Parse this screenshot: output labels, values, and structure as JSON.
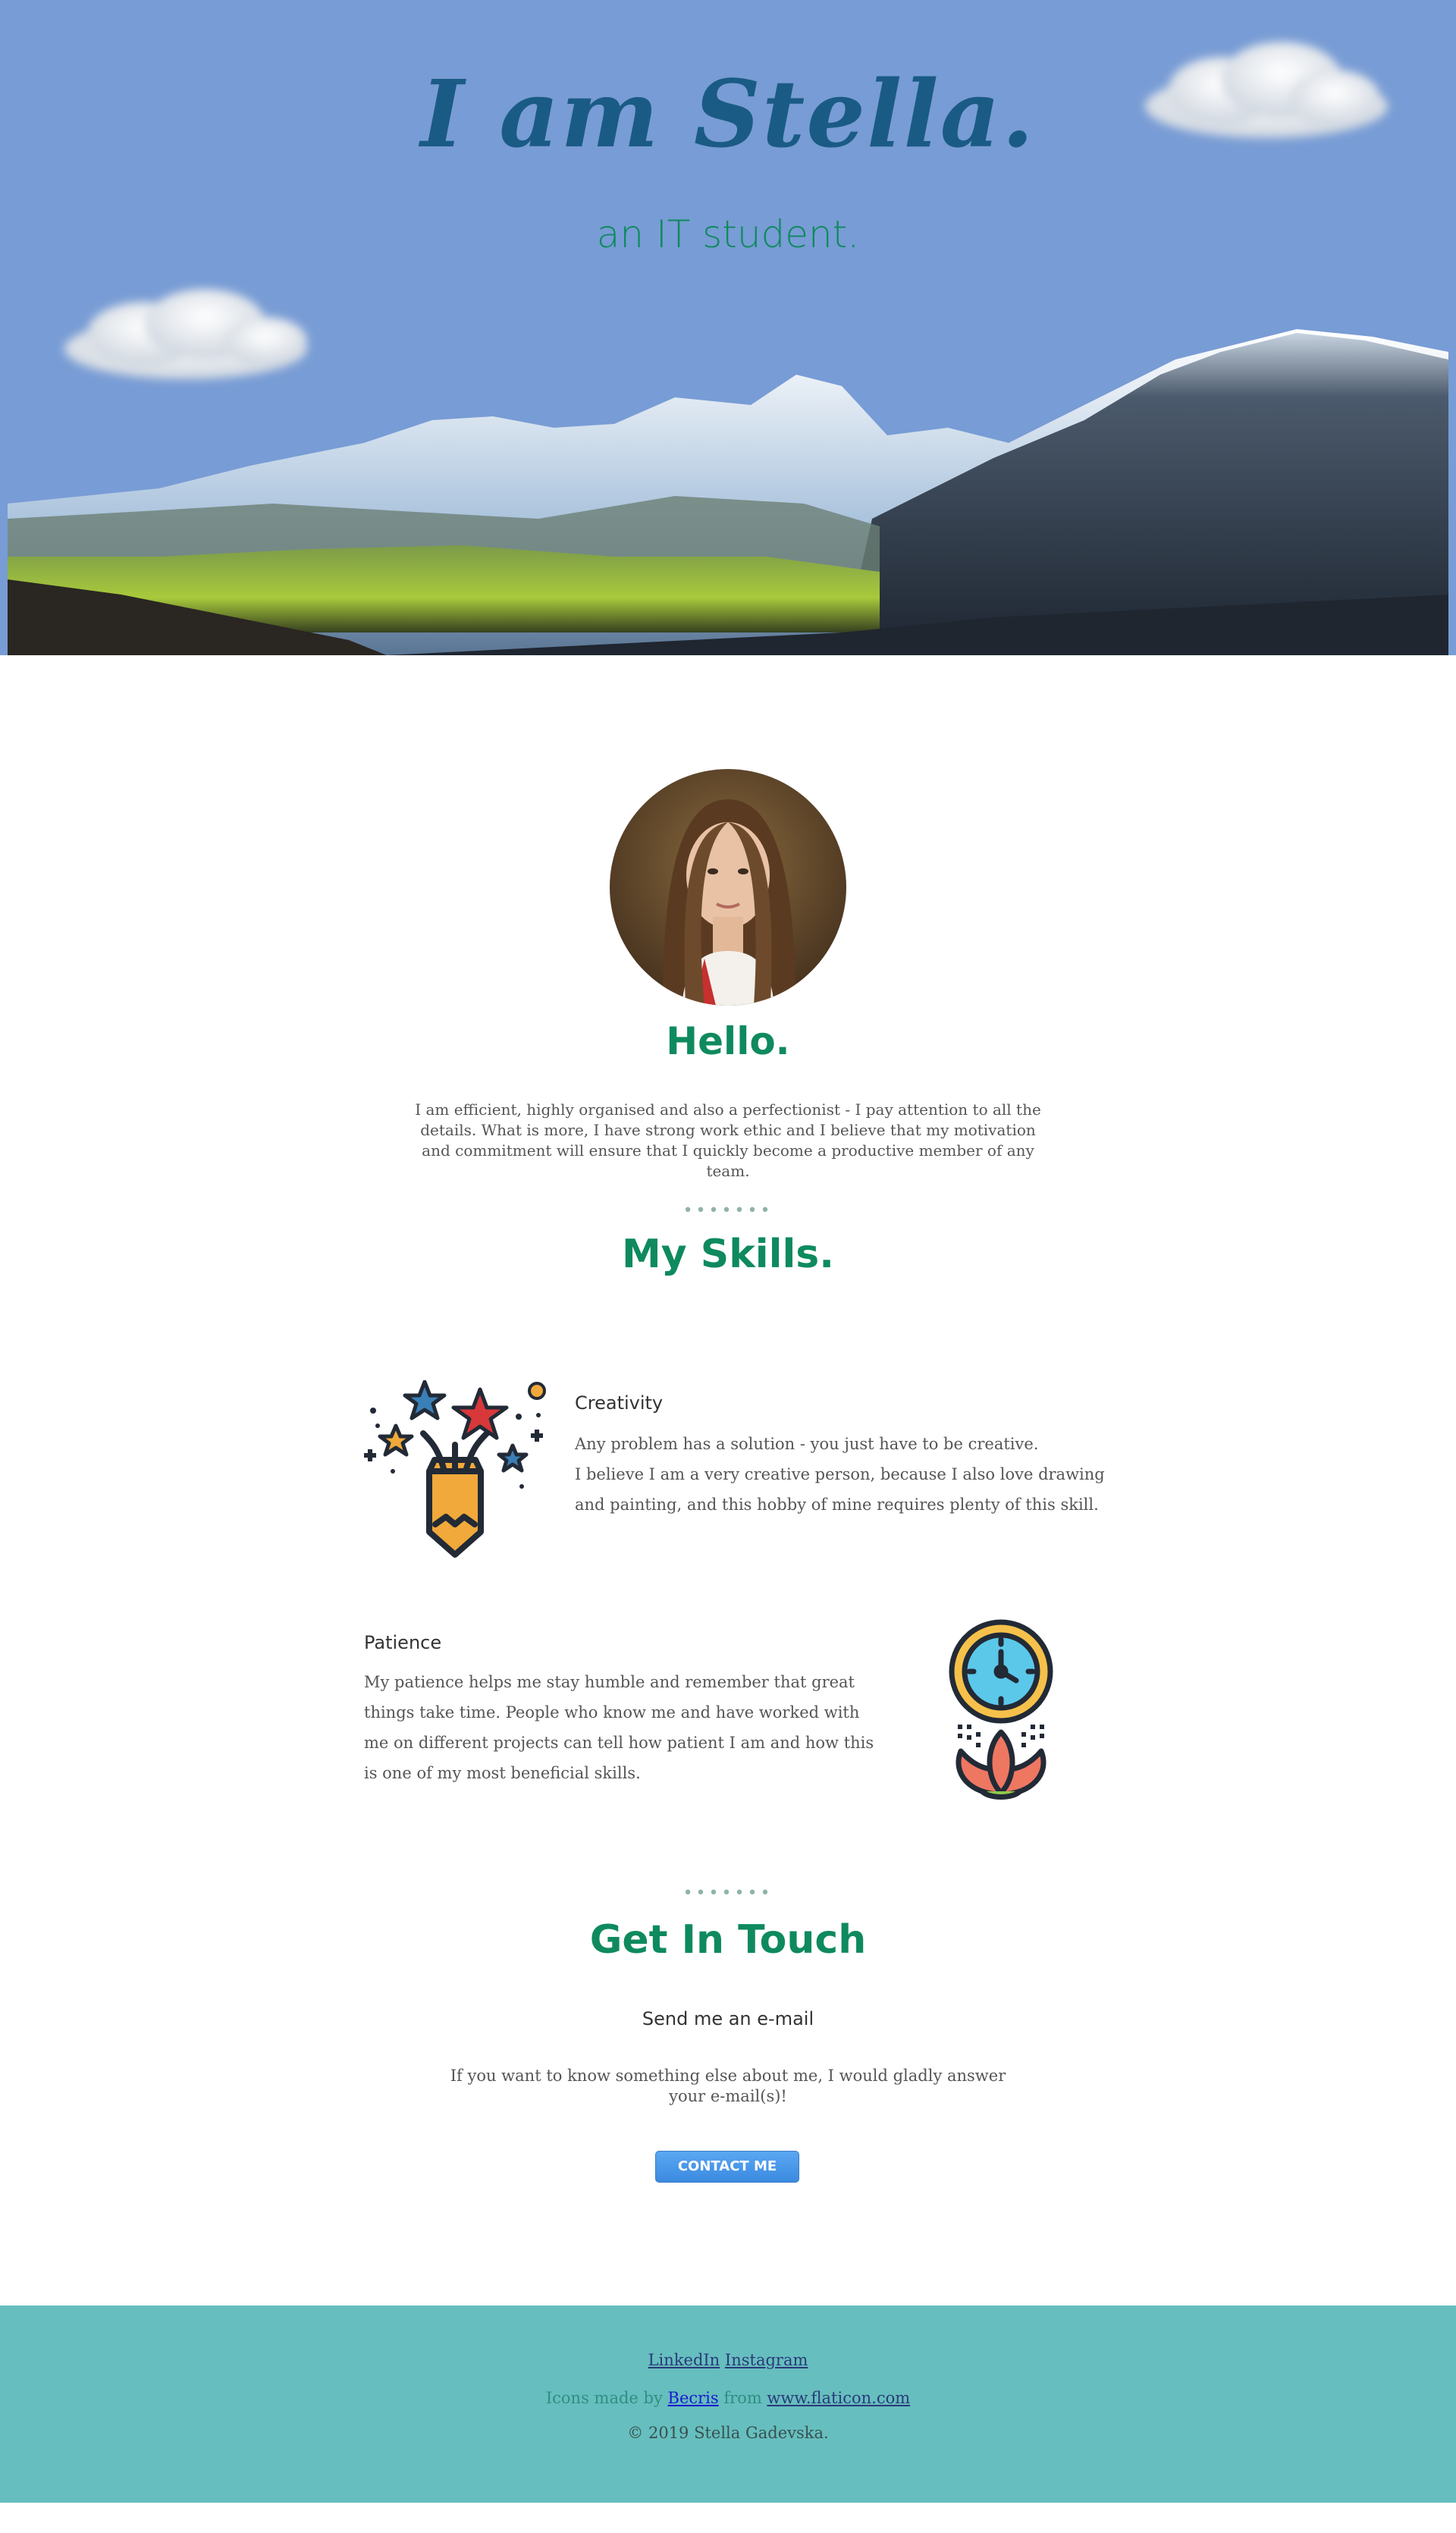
{
  "hero": {
    "title": "I am Stella.",
    "subtitle": "an IT student."
  },
  "about": {
    "heading": "Hello.",
    "text": "I am efficient, highly organised and also a perfectionist - I pay attention to all the details. What is more, I have strong work ethic and I believe that my motivation and commitment will ensure that I quickly become a productive member of any team."
  },
  "skills": {
    "separator": "•••••••",
    "heading": "My Skills.",
    "items": [
      {
        "title": "Creativity",
        "line1": "Any problem has a solution - you just have to be creative.",
        "line2": "I believe I am a very creative person, because I also love drawing and painting, and this hobby of mine requires plenty of this skill.",
        "icon": "creativity-pencil-stars-icon"
      },
      {
        "title": "Patience",
        "text": "My patience helps me stay humble and remember that great things take time. People who know me and have worked with me on different projects can tell how patient I am and how this is one of my most beneficial skills.",
        "icon": "patience-clock-lotus-icon"
      }
    ]
  },
  "contact": {
    "separator": "•••••••",
    "heading": "Get In Touch",
    "subheading": "Send me an e-mail",
    "text": "If you want to know something else about me, I would gladly answer your e-mail(s)!",
    "button": "CONTACT ME"
  },
  "footer": {
    "link_linkedin": "LinkedIn",
    "link_instagram": "Instagram",
    "credit_prefix": "Icons made by",
    "credit_author": "Becris",
    "credit_from": "from",
    "credit_site": "www.flaticon.com",
    "copyright": "© 2019 Stella Gadevska."
  },
  "colors": {
    "hero_bg": "#789cd5",
    "accent_green": "#0e8a5e",
    "title_blue": "#1a5b85",
    "button_blue": "#4a97e8",
    "footer_bg": "#66bebe"
  }
}
